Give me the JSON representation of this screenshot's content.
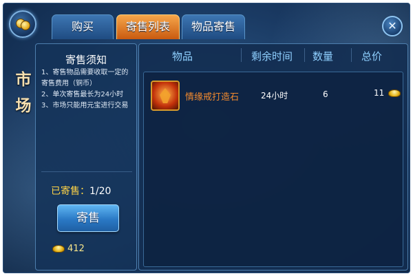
{
  "tabs": {
    "buy": "购买",
    "list": "寄售列表",
    "consign": "物品寄售",
    "active": "寄售列表"
  },
  "side_title": [
    "市",
    "场"
  ],
  "notice": {
    "title": "寄售须知",
    "lines": [
      "1、寄售物品需要收取一定的寄售费用（铜币）",
      "2、单次寄售最长为24小时",
      "3、市场只能用元宝进行交易"
    ]
  },
  "consigned": {
    "label": "已寄售：",
    "value": "1/20"
  },
  "sell_button": "寄售",
  "balance": {
    "icon": "ingot-icon",
    "value": "412"
  },
  "table": {
    "headers": {
      "item": "物品",
      "time_left": "剩余时间",
      "quantity": "数量",
      "total_price": "总价"
    },
    "rows": [
      {
        "name": "情缘戒打造石",
        "time_left": "24小时",
        "quantity": "6",
        "price": "11",
        "price_icon": "ingot-icon"
      }
    ]
  },
  "colors": {
    "accent_tab": "#e0762a",
    "item_name": "#f28a2e",
    "header_text": "#8fd0ff",
    "gold": "#ffd447"
  }
}
